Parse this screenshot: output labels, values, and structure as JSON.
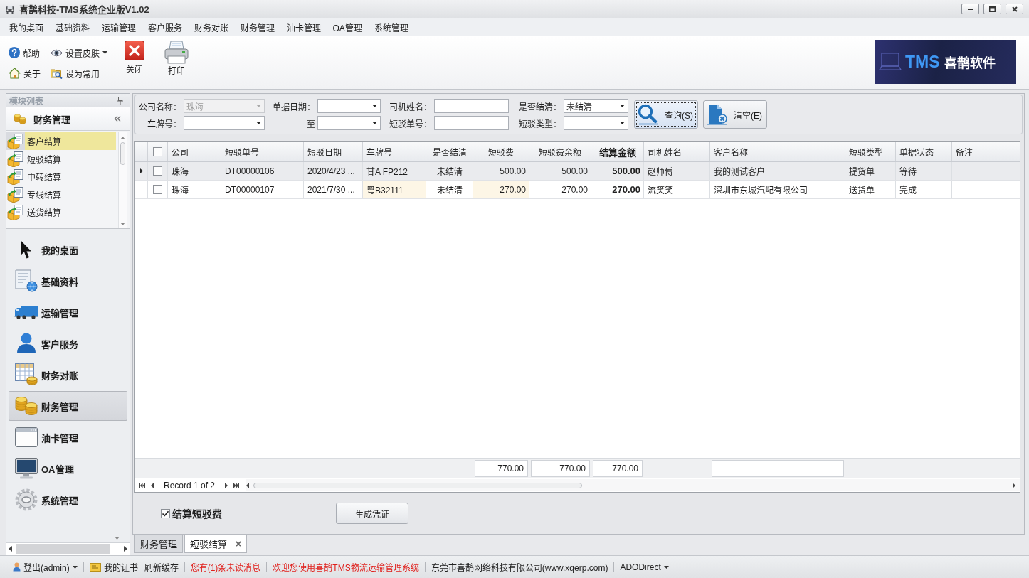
{
  "window": {
    "title": "喜鹊科技-TMS系统企业版V1.02"
  },
  "menu": [
    "我的桌面",
    "基础资料",
    "运输管理",
    "客户服务",
    "财务对账",
    "财务管理",
    "油卡管理",
    "OA管理",
    "系统管理"
  ],
  "toolbar": {
    "small_buttons": [
      {
        "label": "帮助",
        "has_menu": false
      },
      {
        "label": "设置皮肤",
        "has_menu": true
      },
      {
        "label": "关于",
        "has_menu": false
      },
      {
        "label": "设为常用",
        "has_menu": false
      }
    ],
    "large_buttons": [
      "关闭",
      "打印"
    ]
  },
  "logo": {
    "mark": "TMS",
    "name": "喜鹊软件"
  },
  "sidebar": {
    "title": "模块列表",
    "group": "财务管理",
    "items": [
      {
        "label": "客户结算",
        "selected": true
      },
      {
        "label": "短驳结算",
        "selected": false
      },
      {
        "label": "中转结算",
        "selected": false
      },
      {
        "label": "专线结算",
        "selected": false
      },
      {
        "label": "送货结算",
        "selected": false
      }
    ],
    "nav": [
      {
        "label": "我的桌面",
        "selected": false
      },
      {
        "label": "基础资料",
        "selected": false
      },
      {
        "label": "运输管理",
        "selected": false
      },
      {
        "label": "客户服务",
        "selected": false
      },
      {
        "label": "财务对账",
        "selected": false
      },
      {
        "label": "财务管理",
        "selected": true
      },
      {
        "label": "油卡管理",
        "selected": false
      },
      {
        "label": "OA管理",
        "selected": false
      },
      {
        "label": "系统管理",
        "selected": false
      }
    ]
  },
  "filters": [
    {
      "label": "公司名称：",
      "kind": "dropdown",
      "value": "珠海",
      "disabled": true
    },
    {
      "label": "单据日期：",
      "kind": "dropdown",
      "disabled": false
    },
    {
      "label": "司机姓名：",
      "kind": "text",
      "disabled": false
    },
    {
      "label": "是否结清：",
      "kind": "dropdown",
      "value": "未结清",
      "disabled": false
    },
    {
      "label": "车牌号：",
      "kind": "dropdown",
      "disabled": false
    },
    {
      "label": "至",
      "kind": "dropdown",
      "disabled": false
    },
    {
      "label": "短驳单号：",
      "kind": "text",
      "disabled": false
    },
    {
      "label": "短驳类型：",
      "kind": "dropdown",
      "disabled": false
    }
  ],
  "filter_buttons": [
    {
      "label": "查询(S)",
      "focused": true
    },
    {
      "label": "清空(E)",
      "focused": false
    }
  ],
  "table": {
    "all_checked": false,
    "columns": [
      {
        "label": "公司",
        "kind": "text",
        "highlighted": false,
        "emphasized": false,
        "summary": false
      },
      {
        "label": "短驳单号",
        "kind": "text",
        "highlighted": false,
        "emphasized": false,
        "summary": false
      },
      {
        "label": "短驳日期",
        "kind": "text",
        "highlighted": false,
        "emphasized": false,
        "summary": false
      },
      {
        "label": "车牌号",
        "kind": "text",
        "highlighted": true,
        "emphasized": false,
        "summary": false
      },
      {
        "label": "是否结清",
        "kind": "flag",
        "highlighted": false,
        "emphasized": false,
        "summary": false
      },
      {
        "label": "短驳费",
        "kind": "number",
        "highlighted": true,
        "emphasized": false,
        "summary": true,
        "total": "770.00"
      },
      {
        "label": "短驳费余额",
        "kind": "number",
        "highlighted": false,
        "emphasized": false,
        "summary": true,
        "total": "770.00"
      },
      {
        "label": "结算金额",
        "kind": "number",
        "highlighted": false,
        "emphasized": true,
        "summary": true,
        "total": "770.00"
      },
      {
        "label": "司机姓名",
        "kind": "text",
        "highlighted": false,
        "emphasized": false,
        "summary": false
      },
      {
        "label": "客户名称",
        "kind": "text",
        "highlighted": false,
        "emphasized": false,
        "summary": true
      },
      {
        "label": "短驳类型",
        "kind": "text",
        "highlighted": false,
        "emphasized": false,
        "summary": false
      },
      {
        "label": "单据状态",
        "kind": "text",
        "highlighted": false,
        "emphasized": false,
        "summary": false
      },
      {
        "label": "备注",
        "kind": "text",
        "highlighted": false,
        "emphasized": false,
        "summary": false
      }
    ],
    "rows": [
      {
        "selected": true,
        "checked": false,
        "cells": [
          "珠海",
          "DT00000106",
          "2020/4/23 ...",
          "甘A FP212",
          "未结清",
          "500.00",
          "500.00",
          "500.00",
          "赵师傅",
          "我的测试客户",
          "提货单",
          "等待"
        ]
      },
      {
        "selected": false,
        "checked": false,
        "cells": [
          "珠海",
          "DT00000107",
          "2021/7/30 ...",
          "粤B32111",
          "未结清",
          "270.00",
          "270.00",
          "270.00",
          "流笑笑",
          "深圳市东城汽配有限公司",
          "送货单",
          "完成"
        ]
      }
    ],
    "navigator": "Record 1 of 2"
  },
  "settlement_option": {
    "label": "结算短驳费",
    "checked": true
  },
  "actions": [
    "生成凭证"
  ],
  "document_tabs": [
    {
      "label": "财务管理",
      "selected": false,
      "closable": false
    },
    {
      "label": "短驳结算",
      "selected": true,
      "closable": true
    }
  ],
  "status_bar": {
    "sections": [
      [
        {
          "text": "登出(admin)",
          "kind": "user",
          "has_menu": true,
          "color": "#222222"
        }
      ],
      [
        {
          "text": "我的证书",
          "kind": "certificate",
          "has_menu": false,
          "color": "#222222"
        },
        {
          "text": "刷新缓存",
          "kind": "plain",
          "has_menu": false,
          "color": "#222222"
        }
      ],
      [
        {
          "text": "您有(1)条未读消息",
          "kind": "plain",
          "has_menu": false,
          "color": "#e0201c"
        }
      ],
      [
        {
          "text": "欢迎您使用喜鹊TMS物流运输管理系统",
          "kind": "plain",
          "has_menu": false,
          "color": "#e0201c"
        }
      ],
      [
        {
          "text": "东莞市喜鹊网络科技有限公司(www.xqerp.com)",
          "kind": "plain",
          "has_menu": false,
          "color": "#222222"
        }
      ],
      [
        {
          "text": "ADODirect",
          "kind": "plain",
          "has_menu": true,
          "color": "#222222"
        }
      ]
    ]
  }
}
